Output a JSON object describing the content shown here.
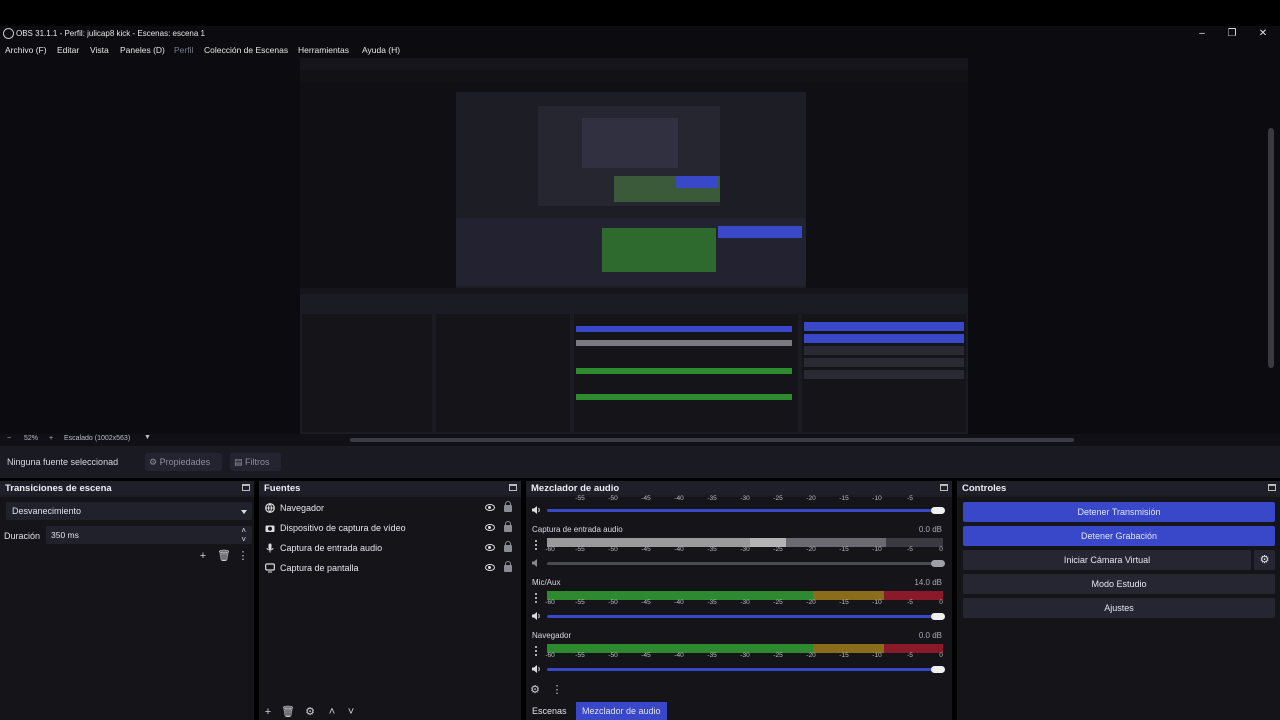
{
  "window": {
    "title": "OBS 31.1.1 - Perfil: julicap8 kick - Escenas: escena 1",
    "controls": [
      "minimize",
      "maximize",
      "close"
    ]
  },
  "menu": {
    "items": [
      "Archivo (F)",
      "Editar",
      "Vista",
      "Paneles (D)",
      "Perfil",
      "Colección de Escenas",
      "Herramientas",
      "Ayuda (H)"
    ]
  },
  "statusbar": {
    "zoom_minus": "−",
    "zoom": "52%",
    "zoom_plus": "+",
    "scale": "Escalado (1002x563)"
  },
  "properties_bar": {
    "no_source": "Ninguna fuente seleccionad",
    "properties": "Propiedades",
    "filters": "Filtros"
  },
  "transitions": {
    "title": "Transiciones de escena",
    "selected": "Desvanecimiento",
    "duration_label": "Duración",
    "duration_value": "350 ms"
  },
  "sources": {
    "title": "Fuentes",
    "items": [
      {
        "label": "Navegador",
        "icon": "globe-icon"
      },
      {
        "label": "Dispositivo de captura de vídeo",
        "icon": "camera-icon"
      },
      {
        "label": "Captura de entrada audio",
        "icon": "microphone-icon"
      },
      {
        "label": "Captura de pantalla",
        "icon": "monitor-icon"
      }
    ]
  },
  "mixer": {
    "title": "Mezclador de audio",
    "ticks": [
      "-60",
      "-55",
      "-50",
      "-45",
      "-40",
      "-35",
      "-30",
      "-25",
      "-20",
      "-15",
      "-10",
      "-5",
      "0"
    ],
    "top_ticks": [
      "-55",
      "-50",
      "-45",
      "-40",
      "-35",
      "-30",
      "-25",
      "-20",
      "-15",
      "-10",
      "-5"
    ],
    "channels": [
      {
        "name": "Captura de entrada audio",
        "db": "0.0 dB",
        "style": "muted"
      },
      {
        "name": "Mic/Aux",
        "db": "14.0 dB",
        "style": "active"
      },
      {
        "name": "Navegador",
        "db": "0.0 dB",
        "style": "active"
      }
    ]
  },
  "controls": {
    "title": "Controles",
    "stop_stream": "Detener Transmisión",
    "stop_record": "Detener Grabación",
    "virtual_cam": "Iniciar Cámara Virtual",
    "studio_mode": "Modo Estudio",
    "settings": "Ajustes"
  },
  "tabs": {
    "scenes": "Escenas",
    "mixer": "Mezclador de audio"
  },
  "colors": {
    "accent": "#3848c8",
    "meter_green": "#2e8a2e",
    "meter_yellow": "#8a6d1a",
    "meter_red": "#8a1a2a"
  }
}
